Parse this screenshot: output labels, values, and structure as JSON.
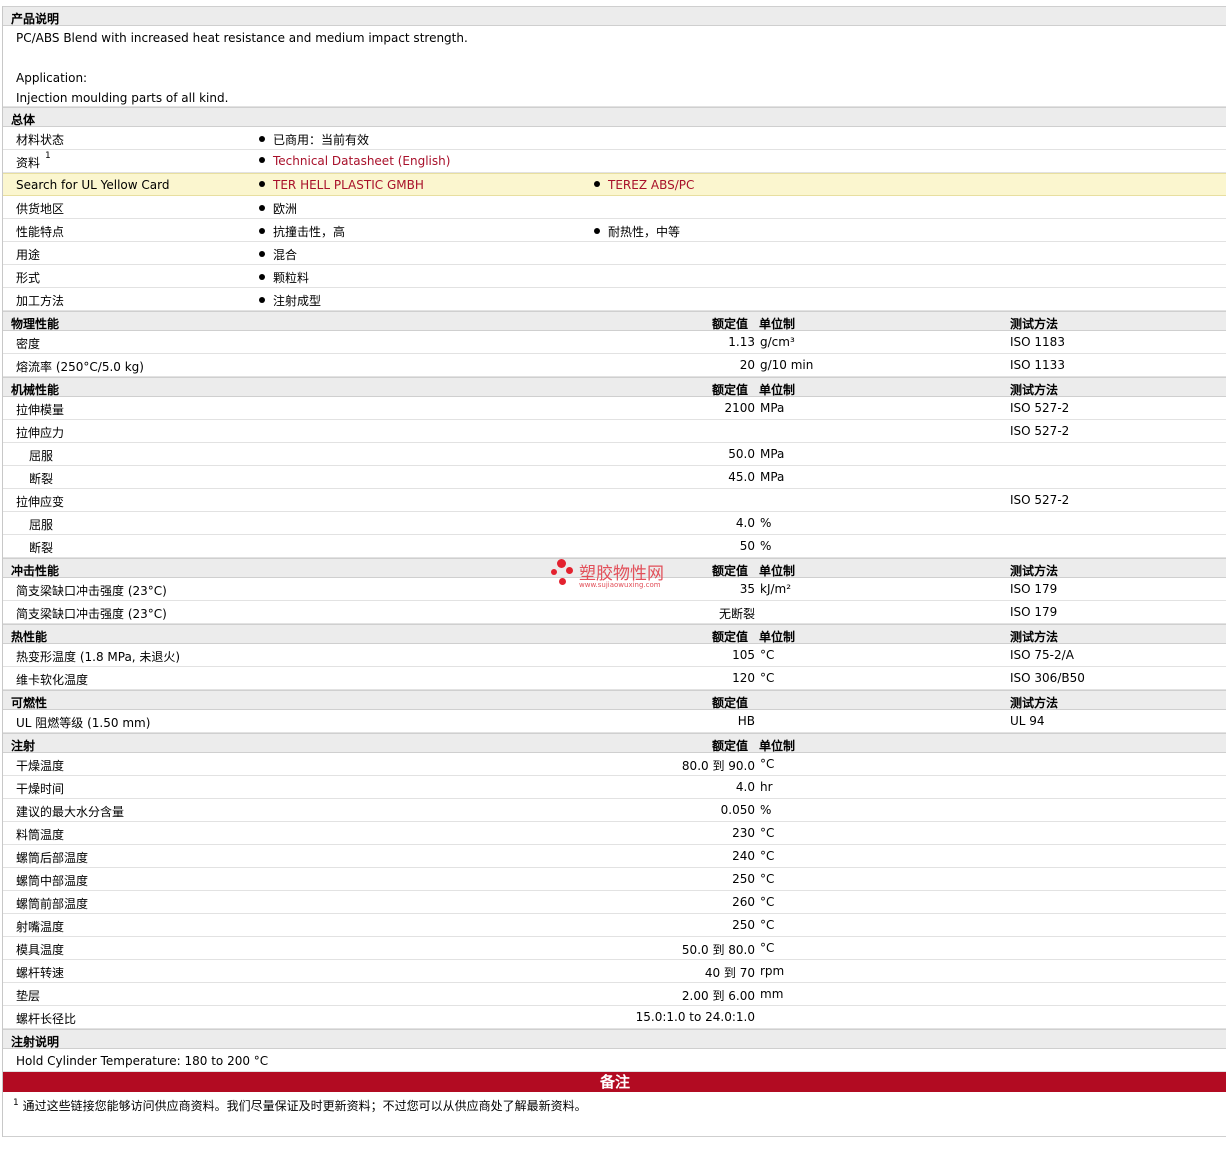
{
  "desc": {
    "title": "产品说明",
    "line1": "PC/ABS Blend with increased heat resistance and medium impact strength.",
    "line2": "Application:",
    "line3": "Injection moulding parts of all kind."
  },
  "general": {
    "title": "总体",
    "rows": [
      {
        "label": "材料状态",
        "v1": "已商用：当前有效"
      },
      {
        "label": "资料",
        "sup": "1",
        "v1": "Technical Datasheet (English)",
        "link1": true
      },
      {
        "label": "Search for UL Yellow Card",
        "v1": "TER HELL PLASTIC GMBH",
        "v2": "TEREZ ABS/PC",
        "link1": true,
        "link2": true,
        "highlight": true
      },
      {
        "label": "供货地区",
        "v1": "欧洲"
      },
      {
        "label": "性能特点",
        "v1": "抗撞击性，高",
        "v2": "耐热性，中等"
      },
      {
        "label": "用途",
        "v1": "混合"
      },
      {
        "label": "形式",
        "v1": "颗粒料"
      },
      {
        "label": "加工方法",
        "v1": "注射成型"
      }
    ]
  },
  "sections": [
    {
      "id": "physical",
      "title": "物理性能",
      "h1": "额定值",
      "h2": "单位制",
      "h3": "测试方法",
      "rows": [
        {
          "label": "密度",
          "value": "1.13",
          "unit": "g/cm³",
          "method": "ISO 1183"
        },
        {
          "label": "熔流率 (250°C/5.0 kg)",
          "value": "20",
          "unit": "g/10 min",
          "method": "ISO 1133"
        }
      ]
    },
    {
      "id": "mechanical",
      "title": "机械性能",
      "h1": "额定值",
      "h2": "单位制",
      "h3": "测试方法",
      "rows": [
        {
          "label": "拉伸模量",
          "value": "2100",
          "unit": "MPa",
          "method": "ISO 527-2"
        },
        {
          "label": "拉伸应力",
          "value": "",
          "unit": "",
          "method": "ISO 527-2"
        },
        {
          "label": "屈服",
          "value": "50.0",
          "unit": "MPa",
          "method": "",
          "sub": true
        },
        {
          "label": "断裂",
          "value": "45.0",
          "unit": "MPa",
          "method": "",
          "sub": true
        },
        {
          "label": "拉伸应变",
          "value": "",
          "unit": "",
          "method": "ISO 527-2"
        },
        {
          "label": "屈服",
          "value": "4.0",
          "unit": "%",
          "method": "",
          "sub": true
        },
        {
          "label": "断裂",
          "value": "50",
          "unit": "%",
          "method": "",
          "sub": true
        }
      ]
    },
    {
      "id": "impact",
      "title": "冲击性能",
      "h1": "额定值",
      "h2": "单位制",
      "h3": "测试方法",
      "rows": [
        {
          "label": "简支梁缺口冲击强度 (23°C)",
          "value": "35",
          "unit": "kJ/m²",
          "method": "ISO 179"
        },
        {
          "label": "简支梁缺口冲击强度 (23°C)",
          "value": "无断裂",
          "unit": "",
          "method": "ISO 179"
        }
      ]
    },
    {
      "id": "thermal",
      "title": "热性能",
      "h1": "额定值",
      "h2": "单位制",
      "h3": "测试方法",
      "rows": [
        {
          "label": "热变形温度 (1.8 MPa, 未退火)",
          "value": "105",
          "unit": "°C",
          "method": "ISO 75-2/A"
        },
        {
          "label": "维卡软化温度",
          "value": "120",
          "unit": "°C",
          "method": "ISO 306/B50"
        }
      ]
    },
    {
      "id": "flammability",
      "title": "可燃性",
      "h1": "额定值",
      "h2": "",
      "h3": "测试方法",
      "rows": [
        {
          "label": "UL 阻燃等级 (1.50 mm)",
          "value": "HB",
          "unit": "",
          "method": "UL 94"
        }
      ]
    },
    {
      "id": "injection",
      "title": "注射",
      "h1": "额定值",
      "h2": "单位制",
      "h3": "",
      "rows": [
        {
          "label": "干燥温度",
          "value": "80.0 到  90.0",
          "unit": "°C",
          "method": ""
        },
        {
          "label": "干燥时间",
          "value": "4.0",
          "unit": "hr",
          "method": ""
        },
        {
          "label": "建议的最大水分含量",
          "value": "0.050",
          "unit": "%",
          "method": ""
        },
        {
          "label": "料筒温度",
          "value": "230",
          "unit": "°C",
          "method": ""
        },
        {
          "label": "螺筒后部温度",
          "value": "240",
          "unit": "°C",
          "method": ""
        },
        {
          "label": "螺筒中部温度",
          "value": "250",
          "unit": "°C",
          "method": ""
        },
        {
          "label": "螺筒前部温度",
          "value": "260",
          "unit": "°C",
          "method": ""
        },
        {
          "label": "射嘴温度",
          "value": "250",
          "unit": "°C",
          "method": ""
        },
        {
          "label": "模具温度",
          "value": "50.0 到  80.0",
          "unit": "°C",
          "method": ""
        },
        {
          "label": "螺杆转速",
          "value": "40 到  70",
          "unit": "rpm",
          "method": ""
        },
        {
          "label": "垫层",
          "value": "2.00 到  6.00",
          "unit": "mm",
          "method": ""
        },
        {
          "label": "螺杆长径比",
          "value": "15.0:1.0 to 24.0:1.0",
          "unit": "",
          "method": ""
        }
      ]
    }
  ],
  "injection_note": {
    "title": "注射说明",
    "text": "Hold Cylinder Temperature: 180 to 200 °C"
  },
  "remarks": {
    "title": "备注",
    "sup": "1",
    "text": "通过这些链接您能够访问供应商资料。我们尽量保证及时更新资料；不过您可以从供应商处了解最新资料。"
  },
  "watermark": {
    "text": "塑胶物性网",
    "url": "www.sujiaowuxing.com"
  }
}
